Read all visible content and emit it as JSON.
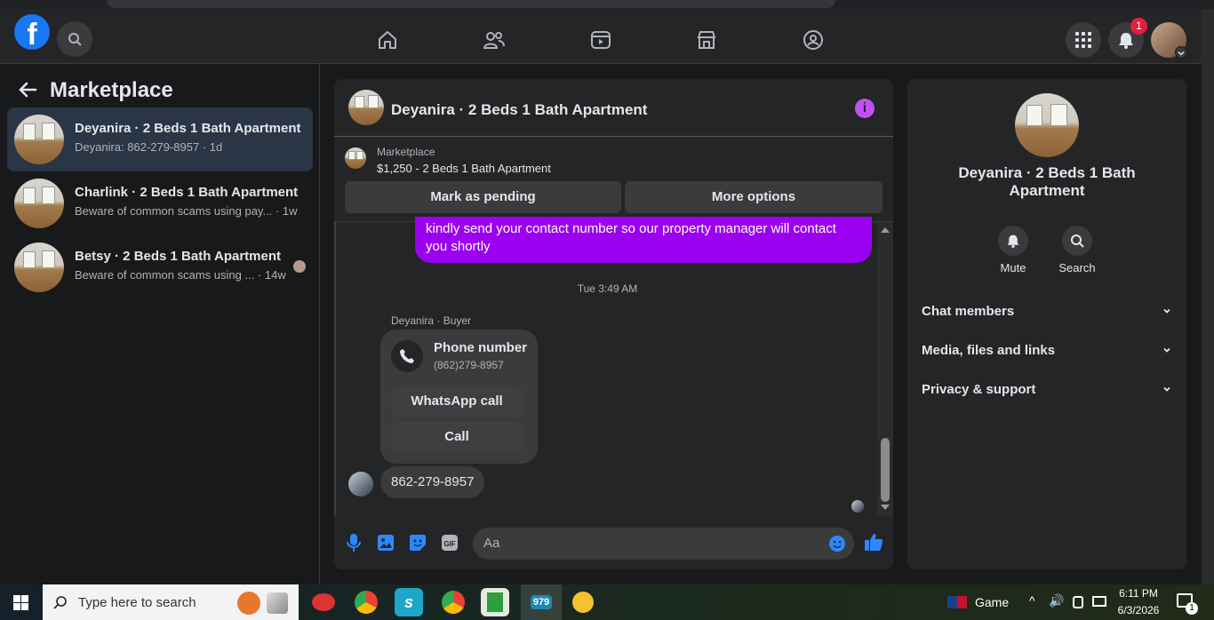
{
  "topbar": {
    "logo_letter": "f",
    "notification_count": "1",
    "nav_icons": [
      "home-icon",
      "friends-icon",
      "video-icon",
      "marketplace-icon",
      "groups-icon"
    ]
  },
  "left": {
    "title": "Marketplace",
    "conversations": [
      {
        "name": "Deyanira · 2 Beds 1 Bath Apartment",
        "preview": "Deyanira: 862-279-8957 · 1d"
      },
      {
        "name": "Charlink · 2 Beds 1 Bath Apartment",
        "preview": "Beware of common scams using pay...  · 1w"
      },
      {
        "name": "Betsy · 2 Beds 1 Bath Apartment",
        "preview": "Beware of common scams using ...  · 14w"
      }
    ]
  },
  "chat": {
    "title": "Deyanira · 2 Beds 1 Bath Apartment",
    "listing_source": "Marketplace",
    "listing_title": "$1,250 - 2 Beds 1 Bath Apartment",
    "mark_pending": "Mark as pending",
    "more_options": "More options",
    "outgoing_message": "kindly send your contact number so our property manager will contact you shortly",
    "timestamp": "Tue 3:49 AM",
    "sender_label": "Deyanira · Buyer",
    "card_title": "Phone number",
    "card_number": "(862)279-8957",
    "whatsapp_call": "WhatsApp call",
    "call": "Call",
    "incoming_message": "862-279-8957",
    "input_placeholder": "Aa"
  },
  "details": {
    "title": "Deyanira · 2 Beds 1 Bath Apartment",
    "mute": "Mute",
    "search": "Search",
    "sections": [
      "Chat members",
      "Media, files and links",
      "Privacy & support"
    ]
  },
  "taskbar": {
    "search_placeholder": "Type here to search",
    "weather_label": "Game",
    "time": "6:11 PM",
    "date": "6/3/2026",
    "notification_count": "1",
    "app_badge": "979"
  },
  "colors": {
    "accent": "#9b00f0",
    "info_icon": "#c050f0",
    "link_blue": "#2d88ff",
    "fb_blue": "#1877f2"
  }
}
